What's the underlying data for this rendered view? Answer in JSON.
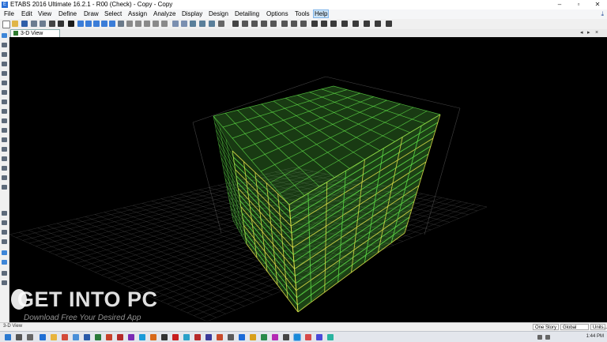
{
  "window": {
    "title": "ETABS 2016 Ultimate 16.2.1 - R00 (Check) - Copy - Copy",
    "app_icon": "E",
    "minimize": "–",
    "maximize": "▫",
    "close": "✕"
  },
  "menu": {
    "items": [
      "File",
      "Edit",
      "View",
      "Define",
      "Draw",
      "Select",
      "Assign",
      "Analyze",
      "Display",
      "Design",
      "Detailing",
      "Options",
      "Tools",
      "Help"
    ],
    "active": "Help",
    "download_icon": "⤓"
  },
  "view_tab": {
    "label": "3-D View",
    "controls": [
      "◂",
      "▸",
      "×"
    ]
  },
  "watermark": {
    "main": "GET INTO PC",
    "sub": "Download Free Your Desired App"
  },
  "statusbar": {
    "view_name": "3-D View",
    "story_select": "One Story",
    "coord_select": "Global",
    "units_button": "Units..."
  },
  "taskbar": {
    "time": "1:44 PM"
  },
  "colors": {
    "frame_green": "#63e84a",
    "frame_yellow": "#e6e84a",
    "grid": "#6a6a6a",
    "menu_active": "#cce4f7"
  }
}
